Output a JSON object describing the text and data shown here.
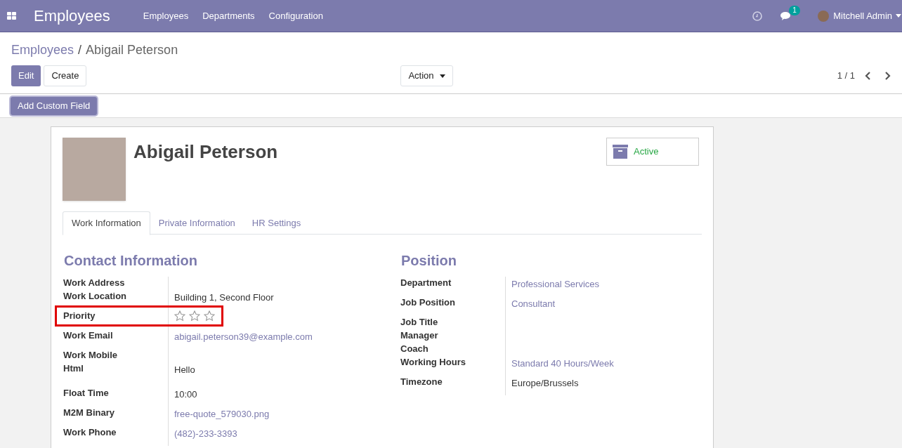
{
  "navbar": {
    "app_title": "Employees",
    "menu": [
      "Employees",
      "Departments",
      "Configuration"
    ],
    "messages_badge": "1",
    "user": "Mitchell Admin"
  },
  "breadcrumb": {
    "parent": "Employees",
    "separator": "/",
    "current": "Abigail Peterson"
  },
  "buttons": {
    "edit": "Edit",
    "create": "Create",
    "action": "Action",
    "add_custom_field": "Add Custom Field"
  },
  "pager": "1 / 1",
  "employee": {
    "name": "Abigail Peterson",
    "status": "Active"
  },
  "tabs": [
    {
      "label": "Work Information",
      "selected": true
    },
    {
      "label": "Private Information",
      "selected": false
    },
    {
      "label": "HR Settings",
      "selected": false
    }
  ],
  "sections": [
    {
      "title": "Contact Information",
      "fields": [
        {
          "label": "Work Address",
          "kind": "empty"
        },
        {
          "label": "Work Location",
          "kind": "text",
          "value": "Building 1, Second Floor"
        },
        {
          "label": "Priority",
          "kind": "stars",
          "stars": 0,
          "highlighted": true
        },
        {
          "label": "Work Email",
          "kind": "link",
          "value": "abigail.peterson39@example.com"
        },
        {
          "label": "Work Mobile",
          "kind": "empty"
        },
        {
          "label": "Html",
          "kind": "html",
          "value": "Hello"
        },
        {
          "label": "Float Time",
          "kind": "text",
          "value": "10:00"
        },
        {
          "label": "M2M Binary",
          "kind": "link",
          "value": "free-quote_579030.png"
        },
        {
          "label": "Work Phone",
          "kind": "link",
          "value": "(482)-233-3393"
        }
      ]
    },
    {
      "title": "Position",
      "fields": [
        {
          "label": "Department",
          "kind": "link",
          "value": "Professional Services"
        },
        {
          "label": "Job Position",
          "kind": "link",
          "value": "Consultant"
        },
        {
          "label": "Job Title",
          "kind": "empty"
        },
        {
          "label": "Manager",
          "kind": "empty"
        },
        {
          "label": "Coach",
          "kind": "empty"
        },
        {
          "label": "Working Hours",
          "kind": "link",
          "value": "Standard 40 Hours/Week"
        },
        {
          "label": "Timezone",
          "kind": "text",
          "value": "Europe/Brussels"
        }
      ]
    }
  ]
}
